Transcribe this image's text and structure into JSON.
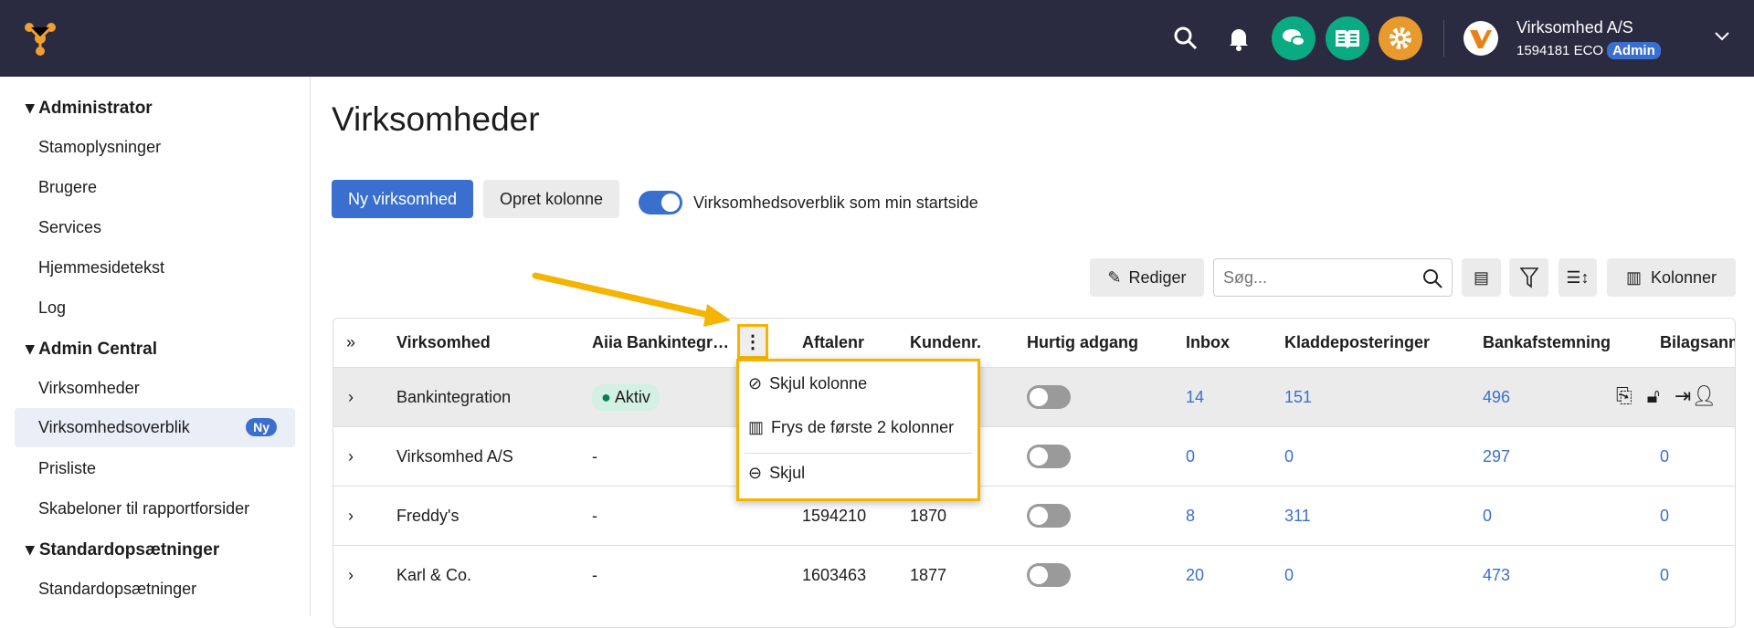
{
  "header": {
    "company": "Virksomhed A/S",
    "account": "1594181 ECO",
    "role_badge": "Admin",
    "accent": "#2a2a40"
  },
  "sidebar": {
    "groups": [
      {
        "label": "Administrator",
        "items": [
          "Stamoplysninger",
          "Brugere",
          "Services",
          "Hjemmesidetekst",
          "Log"
        ]
      },
      {
        "label": "Admin Central",
        "items": [
          "Virksomheder",
          "Virksomhedsoverblik",
          "Prisliste",
          "Skabeloner til rapportforsider"
        ]
      },
      {
        "label": "Standardopsætninger",
        "items": [
          "Standardopsætninger"
        ]
      }
    ],
    "new_badge": "Ny"
  },
  "main": {
    "title": "Virksomheder",
    "new_button": "Ny virksomhed",
    "create_column": "Opret kolonne",
    "startpage_toggle": "Virksomhedsoverblik som min startside",
    "toolbar": {
      "edit": "Rediger",
      "search_placeholder": "Søg...",
      "columns": "Kolonner"
    },
    "table": {
      "headers": [
        "Virksomhed",
        "Aiia Bankintegr…",
        "Aftalenr",
        "Kundenr.",
        "Hurtig adgang",
        "Inbox",
        "Kladdeposteringer",
        "Bankafstemning",
        "Bilagsanm"
      ],
      "rows": [
        {
          "name": "Bankintegration",
          "aiia": "Aktiv",
          "aftalenr": "",
          "kundenr": "",
          "inbox": "14",
          "kladde": "151",
          "bank": "496",
          "bilag": ""
        },
        {
          "name": "Virksomhed A/S",
          "aiia": "-",
          "aftalenr": "",
          "kundenr": "",
          "inbox": "0",
          "kladde": "0",
          "bank": "297",
          "bilag": "0"
        },
        {
          "name": "Freddy's",
          "aiia": "-",
          "aftalenr": "1594210",
          "kundenr": "1870",
          "inbox": "8",
          "kladde": "311",
          "bank": "0",
          "bilag": "0"
        },
        {
          "name": "Karl & Co.",
          "aiia": "-",
          "aftalenr": "1603463",
          "kundenr": "1877",
          "inbox": "20",
          "kladde": "0",
          "bank": "473",
          "bilag": "0"
        }
      ]
    },
    "column_menu": {
      "hide_column": "Skjul kolonne",
      "freeze": "Frys de første 2 kolonner",
      "hide": "Skjul"
    }
  }
}
